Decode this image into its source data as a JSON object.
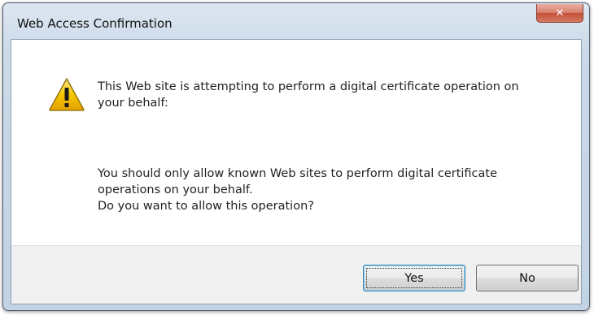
{
  "dialog": {
    "title": "Web Access Confirmation",
    "close_icon": "close-icon",
    "warning_icon": "warning-icon",
    "message_lines": [
      "This Web site is attempting to perform a digital certificate operation on",
      "your behalf:"
    ],
    "detail_lines": [
      "You should only allow known Web sites to perform digital certificate",
      "operations on your behalf.",
      "Do you want to allow this operation?"
    ],
    "buttons": {
      "yes_label": "Yes",
      "no_label": "No"
    }
  },
  "colors": {
    "titlebar": "#cbd9e8",
    "close_button": "#c4503a",
    "warning_yellow": "#f5c400",
    "footer": "#f0f0f0"
  }
}
